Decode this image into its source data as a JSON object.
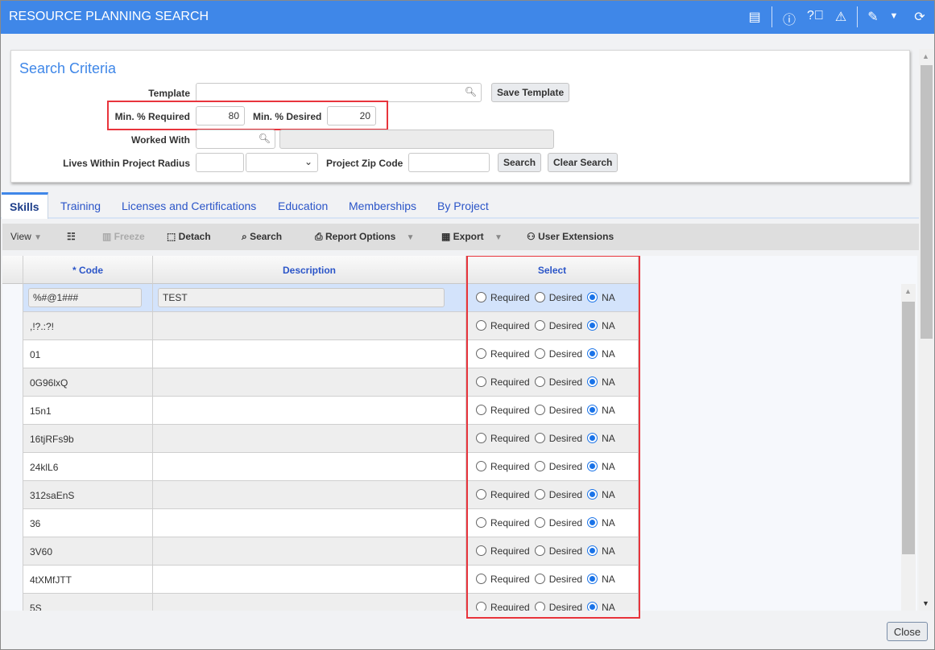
{
  "window": {
    "title": "RESOURCE PLANNING SEARCH",
    "icons": [
      "print-screen-icon",
      "info-icon",
      "help-icon",
      "warning-icon",
      "edit-note-icon",
      "dropdown-icon",
      "refresh-icon"
    ]
  },
  "search": {
    "heading": "Search Criteria",
    "template_label": "Template",
    "template_value": "",
    "save_template": "Save Template",
    "min_required_label": "Min. % Required",
    "min_required": "80",
    "min_desired_label": "Min. % Desired",
    "min_desired": "20",
    "worked_with_label": "Worked With",
    "radius_label": "Lives Within Project Radius",
    "zip_label": "Project Zip Code",
    "search_btn": "Search",
    "clear_btn": "Clear Search"
  },
  "tabs": [
    "Skills",
    "Training",
    "Licenses and Certifications",
    "Education",
    "Memberships",
    "By Project"
  ],
  "toolbar": {
    "view": "View",
    "freeze": "Freeze",
    "detach": "Detach",
    "search": "Search",
    "report_options": "Report Options",
    "export": "Export",
    "user_extensions": "User Extensions"
  },
  "grid": {
    "columns": [
      "* Code",
      "Description",
      "Select"
    ],
    "options": [
      "Required",
      "Desired",
      "NA"
    ],
    "rows": [
      {
        "code": "%#@1###",
        "description": "TEST",
        "select": "NA"
      },
      {
        "code": ",!?.:?!",
        "description": "",
        "select": "NA"
      },
      {
        "code": "01",
        "description": "",
        "select": "NA"
      },
      {
        "code": "0G96lxQ",
        "description": "",
        "select": "NA"
      },
      {
        "code": "15n1",
        "description": "",
        "select": "NA"
      },
      {
        "code": "16tjRFs9b",
        "description": "",
        "select": "NA"
      },
      {
        "code": "24klL6",
        "description": "",
        "select": "NA"
      },
      {
        "code": "312saEnS",
        "description": "",
        "select": "NA"
      },
      {
        "code": "36",
        "description": "",
        "select": "NA"
      },
      {
        "code": "3V60",
        "description": "",
        "select": "NA"
      },
      {
        "code": "4tXMfJTT",
        "description": "",
        "select": "NA"
      },
      {
        "code": "5S",
        "description": "",
        "select": "NA"
      }
    ]
  },
  "footer": {
    "close": "Close"
  },
  "colors": {
    "titlebar": "#3f87e8",
    "highlight": "#e8343c",
    "selected_row": "#d3e3fb"
  }
}
